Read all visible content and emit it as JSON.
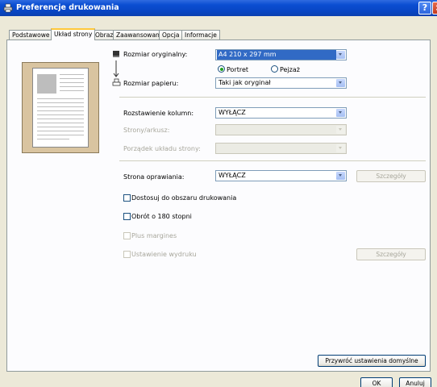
{
  "window": {
    "title": "Preferencje drukowania",
    "help_label": "?",
    "close_label": "×"
  },
  "tabs": [
    {
      "label": "Podstawowe",
      "active": false
    },
    {
      "label": "Układ strony",
      "active": true
    },
    {
      "label": "Obraz",
      "active": false
    },
    {
      "label": "Zaawansowane",
      "active": false
    },
    {
      "label": "Opcja",
      "active": false
    },
    {
      "label": "Informacje",
      "active": false
    }
  ],
  "layout": {
    "original_size": {
      "label": "Rozmiar oryginalny:",
      "value": "A4 210 x 297 mm",
      "icon": "document-icon"
    },
    "orientation": {
      "portrait_label": "Portret",
      "landscape_label": "Pejzaż",
      "selected": "portrait"
    },
    "paper_size": {
      "label": "Rozmiar papieru:",
      "value": "Taki jak oryginał",
      "icon": "printer-icon"
    },
    "columns": {
      "label": "Rozstawienie kolumn:",
      "value": "WYŁĄCZ"
    },
    "pages_per_sheet": {
      "label": "Strony/arkusz:",
      "value": ""
    },
    "page_order": {
      "label": "Porządek układu strony:",
      "value": ""
    },
    "binding": {
      "label": "Strona oprawiania:",
      "value": "WYŁĄCZ",
      "details_label": "Szczegóły"
    },
    "fit_to_print_area": {
      "label": "Dostosuj do obszaru drukowania",
      "checked": false
    },
    "rotate_180": {
      "label": "Obrót o 180 stopni",
      "checked": false
    },
    "plus_margins": {
      "label": "Plus margines",
      "checked": false
    },
    "print_position": {
      "label": "Ustawienie wydruku",
      "checked": false,
      "details_label": "Szczegóły"
    }
  },
  "footer": {
    "restore_defaults_label": "Przywróć ustawienia domyślne",
    "ok_label": "OK",
    "cancel_label": "Anuluj"
  },
  "colors": {
    "titlebar": "#0A4ED2",
    "selection": "#316AC5",
    "panel": "#FCFCFE",
    "dialog": "#ECE9D8"
  }
}
